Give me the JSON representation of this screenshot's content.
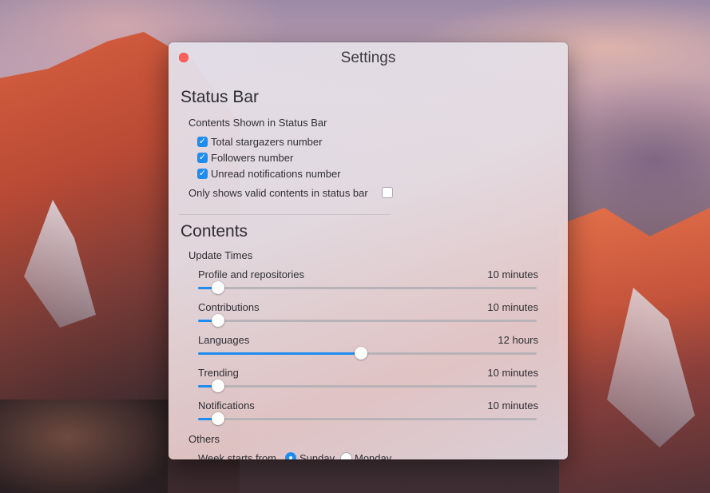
{
  "window": {
    "title": "Settings"
  },
  "status_bar": {
    "heading": "Status Bar",
    "group_label": "Contents Shown in Status Bar",
    "options": [
      {
        "label": "Total stargazers number",
        "checked": true
      },
      {
        "label": "Followers number",
        "checked": true
      },
      {
        "label": "Unread notifications number",
        "checked": true
      }
    ],
    "valid_only": {
      "label": "Only shows valid contents in status bar",
      "checked": false
    }
  },
  "contents": {
    "heading": "Contents",
    "group_label": "Update Times",
    "sliders": [
      {
        "label": "Profile and repositories",
        "value": "10 minutes",
        "level": 0.06
      },
      {
        "label": "Contributions",
        "value": "10 minutes",
        "level": 0.06
      },
      {
        "label": "Languages",
        "value": "12 hours",
        "level": 0.48
      },
      {
        "label": "Trending",
        "value": "10 minutes",
        "level": 0.06
      },
      {
        "label": "Notifications",
        "value": "10 minutes",
        "level": 0.06
      }
    ]
  },
  "others": {
    "label": "Others",
    "week_start": {
      "label": "Week starts from",
      "options": [
        {
          "label": "Sunday",
          "selected": true
        },
        {
          "label": "Monday",
          "selected": false
        }
      ]
    }
  },
  "colors": {
    "accent": "#1e8cf0",
    "close": "#fc605c"
  }
}
